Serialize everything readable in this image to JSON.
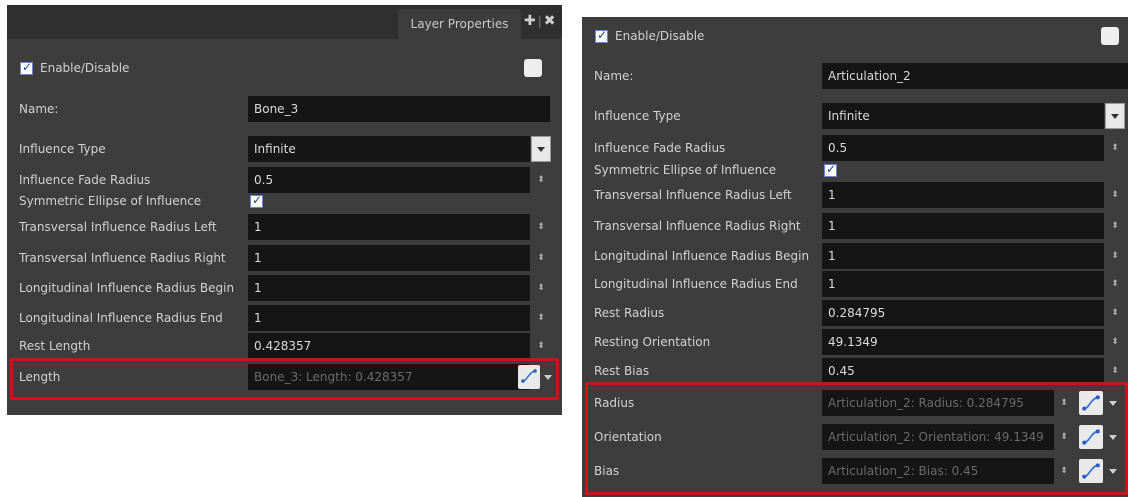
{
  "left": {
    "tab_label": "Layer Properties",
    "tab_add": "✚",
    "tab_sep": "|",
    "tab_close": "✖",
    "enable_label": "Enable/Disable",
    "name_label": "Name:",
    "name_value": "Bone_3",
    "influence_type_label": "Influence Type",
    "influence_type_value": "Infinite",
    "fade_radius_label": "Influence Fade Radius",
    "fade_radius_value": "0.5",
    "symmetric_label": "Symmetric Ellipse of Influence",
    "trans_left_label": "Transversal Influence Radius Left",
    "trans_left_value": "1",
    "trans_right_label": "Transversal Influence Radius Right",
    "trans_right_value": "1",
    "long_begin_label": "Longitudinal Influence Radius Begin",
    "long_begin_value": "1",
    "long_end_label": "Longitudinal Influence Radius End",
    "long_end_value": "1",
    "rest_length_label": "Rest Length",
    "rest_length_value": "0.428357",
    "length_label": "Length",
    "length_value": "Bone_3: Length: 0.428357"
  },
  "right": {
    "enable_label": "Enable/Disable",
    "name_label": "Name:",
    "name_value": "Articulation_2",
    "influence_type_label": "Influence Type",
    "influence_type_value": "Infinite",
    "fade_radius_label": "Influence Fade Radius",
    "fade_radius_value": "0.5",
    "symmetric_label": "Symmetric Ellipse of Influence",
    "trans_left_label": "Transversal Influence Radius Left",
    "trans_left_value": "1",
    "trans_right_label": "Transversal Influence Radius Right",
    "trans_right_value": "1",
    "long_begin_label": "Longitudinal Influence Radius Begin",
    "long_begin_value": "1",
    "long_end_label": "Longitudinal Influence Radius End",
    "long_end_value": "1",
    "rest_radius_label": "Rest Radius",
    "rest_radius_value": "0.284795",
    "resting_orient_label": "Resting Orientation",
    "resting_orient_value": "49.1349",
    "rest_bias_label": "Rest Bias",
    "rest_bias_value": "0.45",
    "radius_label": "Radius",
    "radius_value": "Articulation_2: Radius: 0.284795",
    "orientation_label": "Orientation",
    "orientation_value": "Articulation_2: Orientation: 49.1349",
    "bias_label": "Bias",
    "bias_value": "Articulation_2: Bias: 0.45"
  },
  "glyphs": {
    "check": "✓",
    "spin": "⬍"
  },
  "icons": {
    "function": "function-curve-icon",
    "spinner": "spinner-arrows-icon",
    "dropdown": "chevron-down-icon"
  },
  "colors": {
    "panel_bg": "#3d3d3d",
    "field_bg": "#151515",
    "highlight": "#d0101a",
    "checkbox_tick": "#1e3fa8"
  }
}
